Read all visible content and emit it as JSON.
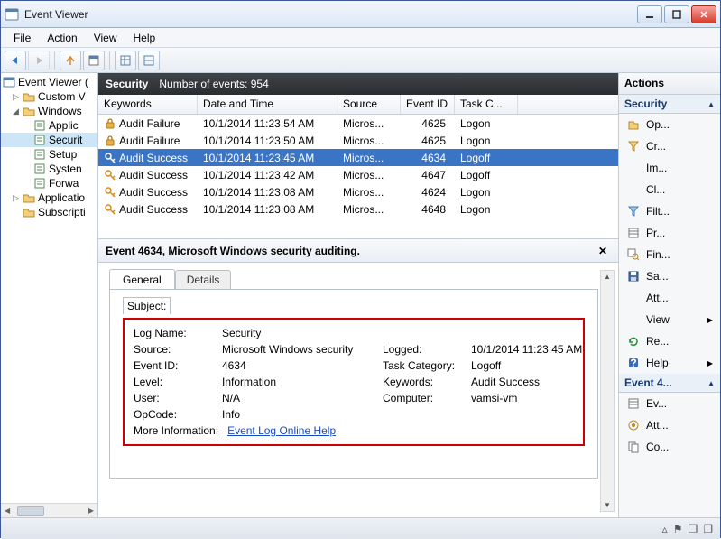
{
  "window": {
    "title": "Event Viewer"
  },
  "menu": {
    "file": "File",
    "action": "Action",
    "view": "View",
    "help": "Help"
  },
  "tree": {
    "root": "Event Viewer (",
    "items": [
      {
        "exp": "▷",
        "label": "Custom V"
      },
      {
        "exp": "◢",
        "label": "Windows"
      },
      {
        "exp": "",
        "label": "Applic",
        "indent": 2
      },
      {
        "exp": "",
        "label": "Securit",
        "indent": 2,
        "sel": true
      },
      {
        "exp": "",
        "label": "Setup",
        "indent": 2
      },
      {
        "exp": "",
        "label": "Systen",
        "indent": 2
      },
      {
        "exp": "",
        "label": "Forwa",
        "indent": 2
      },
      {
        "exp": "▷",
        "label": "Applicatio"
      },
      {
        "exp": "",
        "label": "Subscripti"
      }
    ]
  },
  "centerHeader": {
    "name": "Security",
    "count_label": "Number of events:",
    "count": "954"
  },
  "columns": {
    "kw": "Keywords",
    "dt": "Date and Time",
    "src": "Source",
    "eid": "Event ID",
    "tc": "Task C..."
  },
  "rows": [
    {
      "icon": "lock",
      "kw": "Audit Failure",
      "dt": "10/1/2014 11:23:54 AM",
      "src": "Micros...",
      "eid": "4625",
      "tc": "Logon"
    },
    {
      "icon": "lock",
      "kw": "Audit Failure",
      "dt": "10/1/2014 11:23:50 AM",
      "src": "Micros...",
      "eid": "4625",
      "tc": "Logon"
    },
    {
      "icon": "key",
      "kw": "Audit Success",
      "dt": "10/1/2014 11:23:45 AM",
      "src": "Micros...",
      "eid": "4634",
      "tc": "Logoff",
      "sel": true
    },
    {
      "icon": "key",
      "kw": "Audit Success",
      "dt": "10/1/2014 11:23:42 AM",
      "src": "Micros...",
      "eid": "4647",
      "tc": "Logoff"
    },
    {
      "icon": "key",
      "kw": "Audit Success",
      "dt": "10/1/2014 11:23:08 AM",
      "src": "Micros...",
      "eid": "4624",
      "tc": "Logon"
    },
    {
      "icon": "key",
      "kw": "Audit Success",
      "dt": "10/1/2014 11:23:08 AM",
      "src": "Micros...",
      "eid": "4648",
      "tc": "Logon"
    }
  ],
  "detail": {
    "title": "Event 4634, Microsoft Windows security auditing.",
    "tab_general": "General",
    "tab_details": "Details",
    "subject": "Subject:",
    "labels": {
      "logname": "Log Name:",
      "source": "Source:",
      "eventid": "Event ID:",
      "level": "Level:",
      "user": "User:",
      "opcode": "OpCode:",
      "logged": "Logged:",
      "taskcat": "Task Category:",
      "keywords": "Keywords:",
      "computer": "Computer:",
      "moreinfo": "More Information:"
    },
    "values": {
      "logname": "Security",
      "source": "Microsoft Windows security",
      "eventid": "4634",
      "level": "Information",
      "user": "N/A",
      "opcode": "Info",
      "logged": "10/1/2014 11:23:45 AM",
      "taskcat": "Logoff",
      "keywords": "Audit Success",
      "computer": "vamsi-vm",
      "moreinfo_link": "Event Log Online Help"
    }
  },
  "actions": {
    "title": "Actions",
    "sec1": "Security",
    "items1": [
      {
        "icon": "open",
        "label": "Op..."
      },
      {
        "icon": "funnel-y",
        "label": "Cr..."
      },
      {
        "icon": "blank",
        "label": "Im..."
      },
      {
        "icon": "blank",
        "label": "Cl..."
      },
      {
        "icon": "funnel-b",
        "label": "Filt..."
      },
      {
        "icon": "props",
        "label": "Pr..."
      },
      {
        "icon": "find",
        "label": "Fin..."
      },
      {
        "icon": "save",
        "label": "Sa..."
      },
      {
        "icon": "blank",
        "label": "Att..."
      },
      {
        "icon": "blank",
        "label": "View",
        "arrow": true
      },
      {
        "icon": "refresh",
        "label": "Re..."
      },
      {
        "icon": "help",
        "label": "Help",
        "arrow": true
      }
    ],
    "sec2": "Event 4...",
    "items2": [
      {
        "icon": "props",
        "label": "Ev..."
      },
      {
        "icon": "attach",
        "label": "Att..."
      },
      {
        "icon": "copy",
        "label": "Co..."
      }
    ]
  }
}
